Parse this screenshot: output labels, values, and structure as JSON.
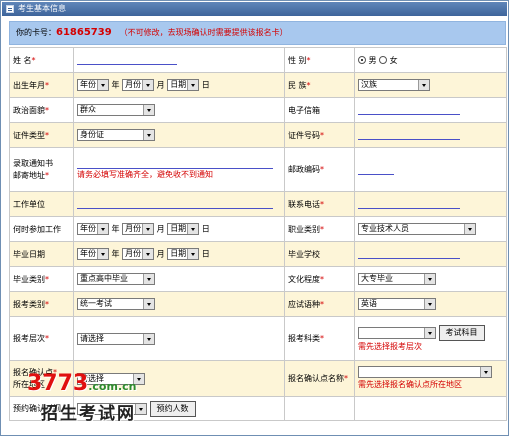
{
  "window": {
    "title": "考生基本信息"
  },
  "card": {
    "label": "你的卡号：",
    "number": "61865739",
    "note": "（不可修改，去现场确认时需要提供该报名卡）"
  },
  "fields": {
    "name": {
      "label": "姓 名",
      "value": ""
    },
    "gender": {
      "label": "性 别",
      "options": [
        "男",
        "女"
      ],
      "selected": "男"
    },
    "birth": {
      "label": "出生年月",
      "year": "年份",
      "year_unit": "年",
      "month": "月份",
      "month_unit": "月",
      "day": "日期",
      "day_unit": "日"
    },
    "ethnicity": {
      "label": "民 族",
      "value": "汉族"
    },
    "politics": {
      "label": "政治面貌",
      "value": "群众"
    },
    "email": {
      "label": "电子信箱",
      "value": ""
    },
    "id_type": {
      "label": "证件类型",
      "value": "身份证"
    },
    "id_number": {
      "label": "证件号码",
      "value": ""
    },
    "mail_address": {
      "label_line1": "录取通知书",
      "label_line2": "邮寄地址",
      "hint": "请务必填写准确齐全，避免收不到通知"
    },
    "postcode": {
      "label": "邮政编码",
      "value": ""
    },
    "workplace": {
      "label": "工作单位",
      "value": ""
    },
    "phone": {
      "label": "联系电话",
      "value": ""
    },
    "work_start": {
      "label": "何时参加工作",
      "year": "年份",
      "year_unit": "年",
      "month": "月份",
      "month_unit": "月",
      "day": "日期",
      "day_unit": "日"
    },
    "occupation": {
      "label": "职业类别",
      "value": "专业技术人员"
    },
    "grad_date": {
      "label": "毕业日期",
      "year": "年份",
      "year_unit": "年",
      "month": "月份",
      "month_unit": "月",
      "day": "日期",
      "day_unit": "日"
    },
    "grad_school": {
      "label": "毕业学校",
      "value": ""
    },
    "grad_type": {
      "label": "毕业类别",
      "value": "重点高中毕业"
    },
    "education": {
      "label": "文化程度",
      "value": "大专毕业"
    },
    "exam_type": {
      "label": "报考类别",
      "value": "统一考试"
    },
    "exam_lang": {
      "label": "应试语种",
      "value": "英语"
    },
    "exam_level": {
      "label": "报考层次",
      "value": "请选择"
    },
    "exam_subject": {
      "label": "报考科类",
      "value": "",
      "button": "考试科目",
      "hint": "需先选择报考层次"
    },
    "confirm_region": {
      "label_line1": "报名确认点",
      "label_line2": "所在地区",
      "value": "请选择"
    },
    "confirm_point": {
      "label": "报名确认点名称",
      "value": "",
      "hint": "需先选择报名确认点所在地区"
    },
    "reserve_time": {
      "label": "预约确认时间",
      "value": "",
      "button": "预约人数"
    }
  },
  "watermark": {
    "site": "3773",
    "domain": ".com.cn",
    "slogan": "招生考试网"
  },
  "colors": {
    "required": "#d40000",
    "card_bar": "#a8c8ee",
    "row_yellow": "#fdf5d8",
    "title_bar": "#3d649b"
  }
}
